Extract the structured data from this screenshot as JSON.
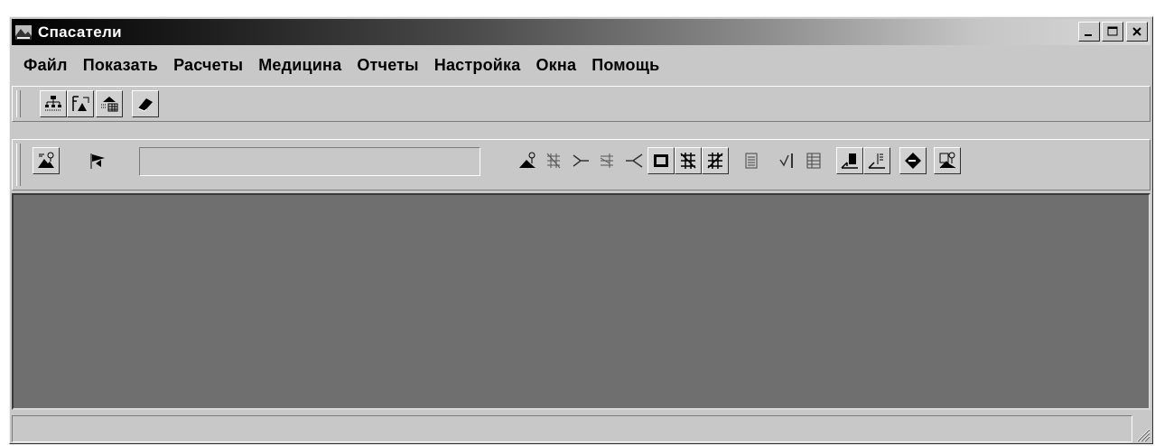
{
  "window": {
    "title": "Спасатели",
    "minimize": "_",
    "maximize": "□",
    "close": "×"
  },
  "menu": [
    "Файл",
    "Показать",
    "Расчеты",
    "Медицина",
    "Отчеты",
    "Настройка",
    "Окна",
    "Помощь"
  ],
  "toolbar1": {
    "buttons": [
      "org-chart-icon",
      "export-icon",
      "import-table-icon",
      "eraser-icon"
    ]
  },
  "toolbar2": {
    "left_buttons": [
      "map-search-icon",
      "pennant-icon"
    ],
    "combo_value": "",
    "right_buttons": [
      "mountain-probe-icon",
      "grid-network-icon",
      "branch-icon",
      "grid-branch-icon",
      "fork-icon",
      "frame-icon",
      "crossed-grid-icon",
      "crossed-grid-alt-icon",
      "list-grid-icon",
      "check-list-icon",
      "table-list-icon",
      "chart-out-icon",
      "chart-list-icon",
      "diamond-icon",
      "report-probe-icon"
    ]
  },
  "statusbar": {
    "text": ""
  }
}
